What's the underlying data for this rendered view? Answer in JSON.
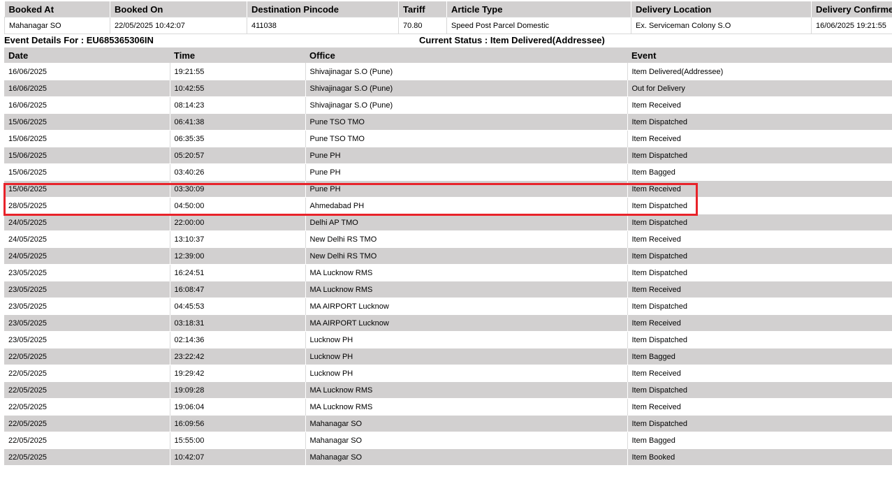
{
  "summary": {
    "headers": [
      "Booked At",
      "Booked On",
      "Destination Pincode",
      "Tariff",
      "Article Type",
      "Delivery Location",
      "Delivery Confirmed On"
    ],
    "row": [
      "Mahanagar SO",
      "22/05/2025 10:42:07",
      "411038",
      "70.80",
      "Speed Post Parcel Domestic",
      "Ex. Serviceman Colony S.O",
      "16/06/2025 19:21:55"
    ]
  },
  "event_details": {
    "label": "Event Details For : EU685365306IN",
    "status": "Current Status : Item Delivered(Addressee)"
  },
  "events": {
    "headers": [
      "Date",
      "Time",
      "Office",
      "Event"
    ],
    "rows": [
      [
        "16/06/2025",
        "19:21:55",
        "Shivajinagar S.O (Pune)",
        "Item Delivered(Addressee)"
      ],
      [
        "16/06/2025",
        "10:42:55",
        "Shivajinagar S.O (Pune)",
        "Out for Delivery"
      ],
      [
        "16/06/2025",
        "08:14:23",
        "Shivajinagar S.O (Pune)",
        "Item Received"
      ],
      [
        "15/06/2025",
        "06:41:38",
        "Pune TSO TMO",
        "Item Dispatched"
      ],
      [
        "15/06/2025",
        "06:35:35",
        "Pune TSO TMO",
        "Item Received"
      ],
      [
        "15/06/2025",
        "05:20:57",
        "Pune PH",
        "Item Dispatched"
      ],
      [
        "15/06/2025",
        "03:40:26",
        "Pune PH",
        "Item Bagged"
      ],
      [
        "15/06/2025",
        "03:30:09",
        "Pune PH",
        "Item Received"
      ],
      [
        "28/05/2025",
        "04:50:00",
        "Ahmedabad PH",
        "Item Dispatched"
      ],
      [
        "24/05/2025",
        "22:00:00",
        "Delhi AP TMO",
        "Item Dispatched"
      ],
      [
        "24/05/2025",
        "13:10:37",
        "New Delhi RS TMO",
        "Item Received"
      ],
      [
        "24/05/2025",
        "12:39:00",
        "New Delhi RS TMO",
        "Item Dispatched"
      ],
      [
        "23/05/2025",
        "16:24:51",
        "MA Lucknow RMS",
        "Item Dispatched"
      ],
      [
        "23/05/2025",
        "16:08:47",
        "MA Lucknow RMS",
        "Item Received"
      ],
      [
        "23/05/2025",
        "04:45:53",
        "MA AIRPORT Lucknow",
        "Item Dispatched"
      ],
      [
        "23/05/2025",
        "03:18:31",
        "MA AIRPORT Lucknow",
        "Item Received"
      ],
      [
        "23/05/2025",
        "02:14:36",
        "Lucknow PH",
        "Item Dispatched"
      ],
      [
        "22/05/2025",
        "23:22:42",
        "Lucknow PH",
        "Item Bagged"
      ],
      [
        "22/05/2025",
        "19:29:42",
        "Lucknow PH",
        "Item Received"
      ],
      [
        "22/05/2025",
        "19:09:28",
        "MA Lucknow RMS",
        "Item Dispatched"
      ],
      [
        "22/05/2025",
        "19:06:04",
        "MA Lucknow RMS",
        "Item Received"
      ],
      [
        "22/05/2025",
        "16:09:56",
        "Mahanagar SO",
        "Item Dispatched"
      ],
      [
        "22/05/2025",
        "15:55:00",
        "Mahanagar SO",
        "Item Bagged"
      ],
      [
        "22/05/2025",
        "10:42:07",
        "Mahanagar SO",
        "Item Booked"
      ]
    ]
  },
  "colors": {
    "header_bg": "#d2d0d0",
    "alt_row_bg": "#d2d0d0",
    "highlight_border": "#e8232a"
  }
}
